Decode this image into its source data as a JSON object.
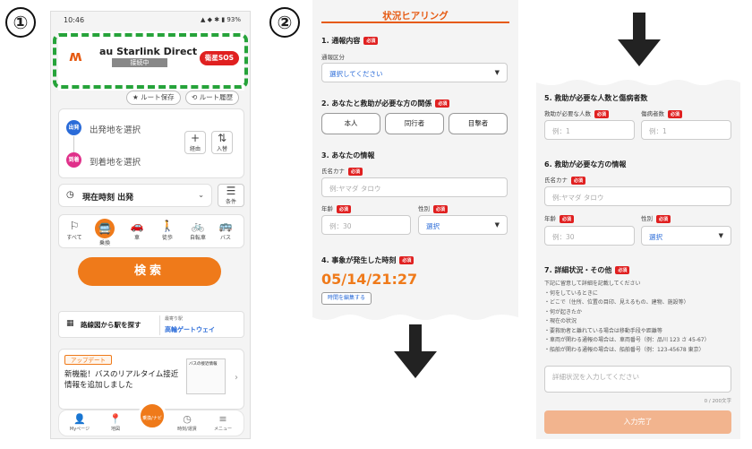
{
  "steps": {
    "one": "①",
    "two": "②"
  },
  "phone": {
    "status_time": "10:46",
    "status_right": "▲ ◆ ✱ ▮ 93%",
    "banner": {
      "title": "au Starlink Direct",
      "status": "接続中",
      "sos_label": "衛星SOS"
    },
    "route_save": "ルート保存",
    "route_history": "ルート履歴",
    "departure_badge": "出発",
    "arrival_badge": "到着",
    "departure_placeholder": "出発地を選択",
    "arrival_placeholder": "到着地を選択",
    "via_label": "経由",
    "swap_label": "入替",
    "time_label": "現在時刻 出発",
    "conditions_label": "条件",
    "modes": [
      "すべて",
      "乗換",
      "車",
      "徒歩",
      "自転車",
      "バス"
    ],
    "search_label": "検索",
    "map_label": "路線図から駅を探す",
    "nearest_label": "最寄り駅",
    "nearest_station": "高輪ゲートウェイ",
    "update_badge": "アップデート",
    "news_text": "新機能！バスのリアルタイム接近情報を追加しました",
    "news_thumb": "バスの接近情報",
    "nav": [
      "Myページ",
      "地図",
      "乗換/ナビ",
      "時刻/運賃",
      "メニュー"
    ]
  },
  "form1": {
    "title": "状況ヒアリング",
    "required": "必須",
    "s1_title": "1. 通報内容",
    "s1_label": "通報区分",
    "s1_select": "選択してください",
    "s2_title": "2. あなたと救助が必要な方の関係",
    "s2_choices": [
      "本人",
      "同行者",
      "目撃者"
    ],
    "s3_title": "3. あなたの情報",
    "kana_label": "氏名カナ",
    "kana_placeholder": "例:ヤマダ タロウ",
    "age_label": "年齢",
    "age_placeholder": "例：30",
    "gender_label": "性別",
    "gender_select": "選択",
    "s4_title": "4. 事象が発生した時刻",
    "time_value": "05/14/21:27",
    "edit_label": "時間を編集する"
  },
  "form2": {
    "s5_title": "5. 救助が必要な人数と傷病者数",
    "people_label": "救助が必要な人数",
    "injured_label": "傷病者数",
    "people_placeholder": "例：1",
    "injured_placeholder": "例：1",
    "s6_title": "6. 救助が必要な方の情報",
    "kana_label": "氏名カナ",
    "kana_placeholder": "例:ヤマダ タロウ",
    "age_label": "年齢",
    "age_placeholder": "例：30",
    "gender_label": "性別",
    "gender_select": "選択",
    "s7_title": "7. 詳細状況・その他",
    "notes": [
      "下記に留意して詳細を記載してください",
      "・何をしているときに",
      "・どこで（住所、位置の目印、見えるもの、建物、施設等）",
      "・何が起きたか",
      "・現在の状況",
      "・要救助者と離れている場合は移動手段や距離等",
      "・車両が関わる通報の場合は、車両番号（例：品川 123 さ 45-67）",
      "・船舶が関わる通報の場合は、船舶番号（例：123-45678 東京）"
    ],
    "detail_placeholder": "詳細状況を入力してください",
    "char_count": "0 / 200文字",
    "submit_label": "入力完了",
    "required": "必須"
  },
  "colors": {
    "accent": "#ef7a1a",
    "required_red": "#e02020",
    "dashed_green": "#26a33a",
    "link_blue": "#2a6bd8"
  }
}
